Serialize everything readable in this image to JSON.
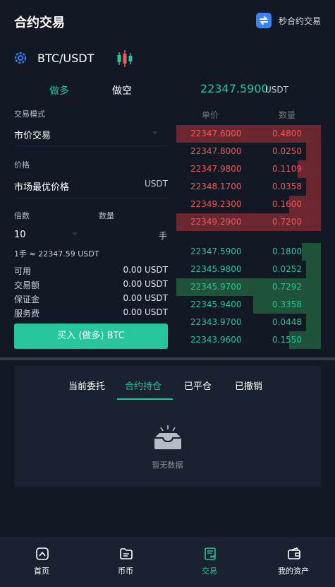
{
  "header": {
    "title": "合约交易",
    "quick_link": "秒合约交易"
  },
  "pair": {
    "name": "BTC/USDT"
  },
  "side_tabs": {
    "long": "做多",
    "short": "做空"
  },
  "last_price": {
    "value": "22347.5900",
    "unit": "USDT"
  },
  "form": {
    "mode_label": "交易模式",
    "mode_value": "市价交易",
    "price_label": "价格",
    "price_value": "市场最优价格",
    "price_unit": "USDT",
    "leverage_label": "倍数",
    "quantity_label": "数量",
    "leverage_value": "10",
    "quantity_unit": "手",
    "lot_note": "1手 ≈ 22347.59 USDT"
  },
  "info": [
    {
      "label": "可用",
      "value": "0.00 USDT"
    },
    {
      "label": "交易额",
      "value": "0.00 USDT"
    },
    {
      "label": "保证金",
      "value": "0.00 USDT"
    },
    {
      "label": "服务费",
      "value": "0.00 USDT"
    }
  ],
  "buy_button": "买入 (做多) BTC",
  "orderbook": {
    "price_header": "单价",
    "qty_header": "数量",
    "asks": [
      {
        "price": "22347.6000",
        "qty": "0.4800",
        "depth": 1.0
      },
      {
        "price": "22347.8000",
        "qty": "0.0250",
        "depth": 0.1
      },
      {
        "price": "22347.9800",
        "qty": "0.1109",
        "depth": 0.16
      },
      {
        "price": "22348.1700",
        "qty": "0.0358",
        "depth": 0.1
      },
      {
        "price": "22349.2300",
        "qty": "0.1600",
        "depth": 0.22
      },
      {
        "price": "22349.2900",
        "qty": "0.7200",
        "depth": 1.0
      }
    ],
    "bids": [
      {
        "price": "22347.5900",
        "qty": "0.1800",
        "depth": 0.13
      },
      {
        "price": "22345.9800",
        "qty": "0.0252",
        "depth": 0.1
      },
      {
        "price": "22345.9700",
        "qty": "0.7292",
        "depth": 1.0
      },
      {
        "price": "22345.9400",
        "qty": "0.3358",
        "depth": 0.47
      },
      {
        "price": "22343.9700",
        "qty": "0.0448",
        "depth": 0.1
      },
      {
        "price": "22343.9600",
        "qty": "0.1550",
        "depth": 0.22
      }
    ]
  },
  "order_tabs": [
    "当前委托",
    "合约持仓",
    "已平仓",
    "已撤销"
  ],
  "empty_text": "暂无数据",
  "nav": [
    {
      "label": "首页",
      "icon": "home-icon"
    },
    {
      "label": "币币",
      "icon": "wallet-icon"
    },
    {
      "label": "交易",
      "icon": "trade-icon"
    },
    {
      "label": "我的资产",
      "icon": "assets-icon"
    }
  ],
  "colors": {
    "accent_green": "#26c59a",
    "ask_red": "#f0585d",
    "background": "#121824",
    "quick_icon_blue": "#3b82f6"
  }
}
